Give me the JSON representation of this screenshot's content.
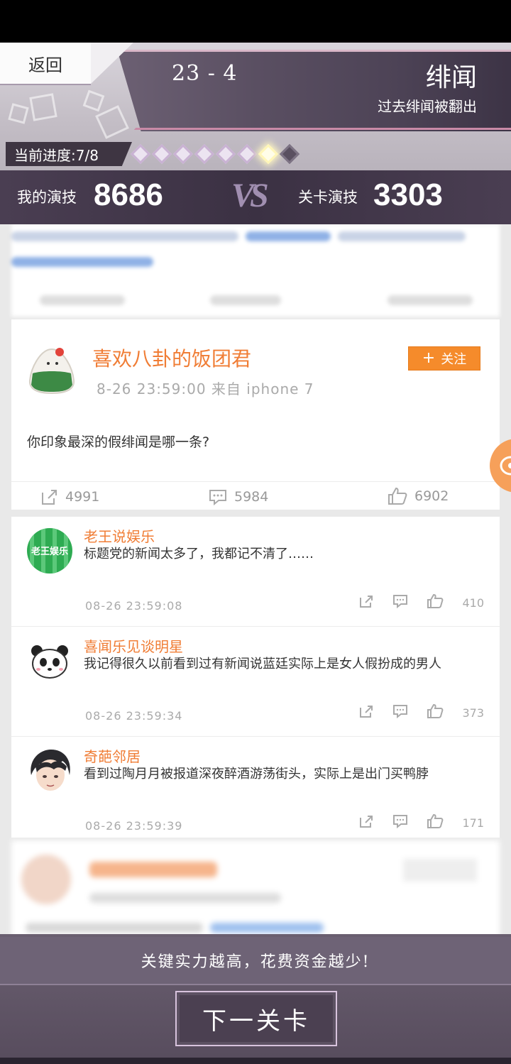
{
  "header": {
    "back_label": "返回",
    "level": "23 - 4",
    "event_title": "绯闻",
    "event_subtitle": "过去绯闻被翻出",
    "progress_label": "当前进度:7/8",
    "progress": {
      "current": 7,
      "total": 8
    }
  },
  "score": {
    "my_label": "我的演技",
    "my_value": "8686",
    "vs": "VS",
    "stage_label": "关卡演技",
    "stage_value": "3303"
  },
  "post": {
    "username": "喜欢八卦的饭团君",
    "meta": "8-26  23:59:00 来自 iphone 7",
    "follow_label": "关注",
    "content": "你印象最深的假绯闻是哪一条?",
    "shares": "4991",
    "comments": "5984",
    "likes": "6902"
  },
  "comments": [
    {
      "name": "老王说娱乐",
      "avatar_text": "老王娱乐",
      "text": "标题党的新闻太多了，我都记不清了……",
      "time": "08-26 23:59:08",
      "likes": "410"
    },
    {
      "name": "喜闻乐见谈明星",
      "text": "我记得很久以前看到过有新闻说蓝廷实际上是女人假扮成的男人",
      "time": "08-26 23:59:34",
      "likes": "373"
    },
    {
      "name": "奇葩邻居",
      "text": "看到过陶月月被报道深夜醉酒游荡街头，实际上是出门买鸭脖",
      "time": "08-26 23:59:39",
      "likes": "171"
    }
  ],
  "footer": {
    "hint": "关键实力越高，花费资金越少!",
    "next_label": "下一关卡"
  },
  "colors": {
    "accent_orange": "#f07d35",
    "follow_bg": "#f58b2b",
    "header_banner": "#4d4356"
  }
}
